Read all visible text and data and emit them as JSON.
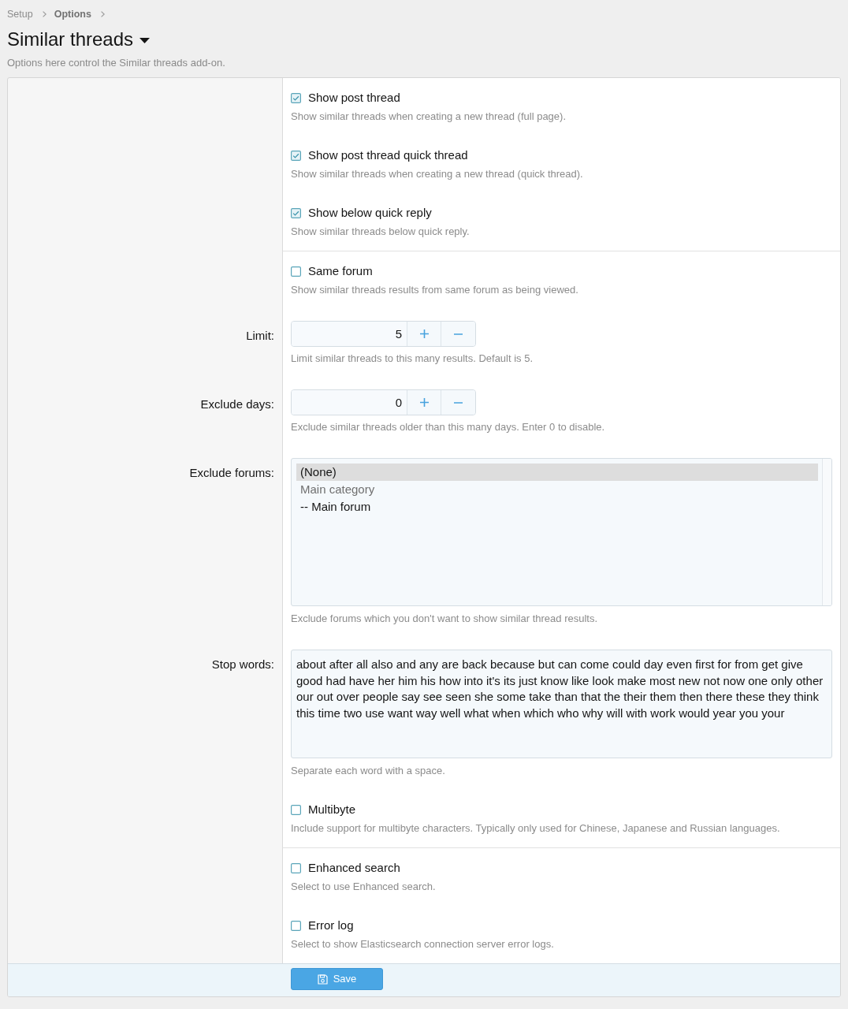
{
  "breadcrumb": [
    {
      "label": "Setup",
      "current": false
    },
    {
      "label": "Options",
      "current": true
    }
  ],
  "title": "Similar threads",
  "description": "Options here control the Similar threads add-on.",
  "groups": [
    {
      "rows": [
        {
          "kind": "checkbox",
          "label": "Show post thread",
          "checked": true,
          "hint": "Show similar threads when creating a new thread (full page)."
        },
        {
          "kind": "checkbox",
          "label": "Show post thread quick thread",
          "checked": true,
          "hint": "Show similar threads when creating a new thread (quick thread)."
        },
        {
          "kind": "checkbox",
          "label": "Show below quick reply",
          "checked": true,
          "hint": "Show similar threads below quick reply."
        }
      ]
    },
    {
      "rows": [
        {
          "kind": "checkbox",
          "label": "Same forum",
          "checked": false,
          "hint": "Show similar threads results from same forum as being viewed."
        },
        {
          "kind": "spinbox",
          "label": "Limit:",
          "value": "5",
          "hint": "Limit similar threads to this many results. Default is 5."
        },
        {
          "kind": "spinbox",
          "label": "Exclude days:",
          "value": "0",
          "hint": "Exclude similar threads older than this many days. Enter 0 to disable."
        },
        {
          "kind": "listbox",
          "label": "Exclude forums:",
          "options": [
            {
              "text": "(None)",
              "selected": true,
              "disabled": false
            },
            {
              "text": "Main category",
              "selected": false,
              "disabled": true
            },
            {
              "text": "-- Main forum",
              "selected": false,
              "disabled": false
            }
          ],
          "hint": "Exclude forums which you don't want to show similar thread results."
        },
        {
          "kind": "textarea",
          "label": "Stop words:",
          "value": "about after all also and any are back because but can come could day even first for from get give good had have her him his how into it's its just know like look make most new not now one only other our out over people say see seen she some take than that the their them then there these they think this time two use want way well what when which who why will with work would year you your",
          "hint": "Separate each word with a space."
        },
        {
          "kind": "checkbox",
          "label": "Multibyte",
          "checked": false,
          "hint": "Include support for multibyte characters. Typically only used for Chinese, Japanese and Russian languages."
        }
      ]
    },
    {
      "rows": [
        {
          "kind": "checkbox",
          "label": "Enhanced search",
          "checked": false,
          "hint": "Select to use Enhanced search."
        },
        {
          "kind": "checkbox",
          "label": "Error log",
          "checked": false,
          "hint": "Select to show Elasticsearch connection server error logs."
        }
      ]
    }
  ],
  "footer": {
    "save_button": "Save"
  }
}
